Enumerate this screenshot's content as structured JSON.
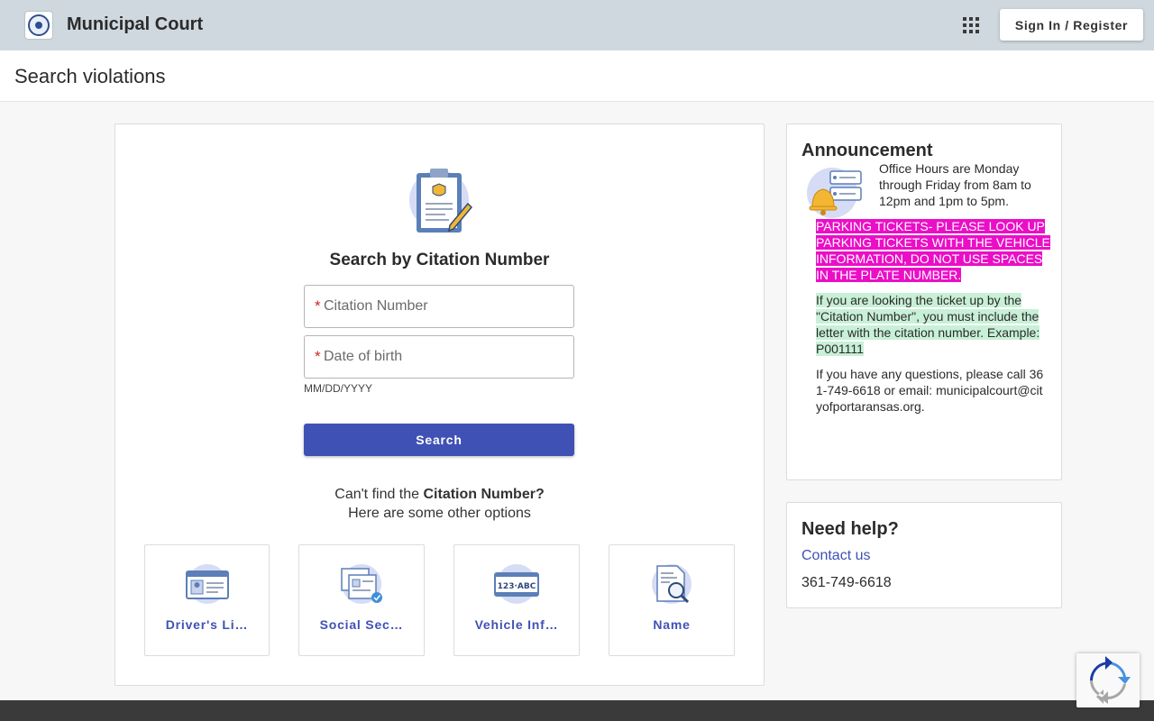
{
  "header": {
    "app_title": "Municipal Court",
    "signin_label": "Sign In / Register"
  },
  "page": {
    "title": "Search violations"
  },
  "search": {
    "heading": "Search by Citation Number",
    "citation_placeholder": "Citation Number",
    "dob_placeholder": "Date of birth",
    "dob_hint": "MM/DD/YYYY",
    "button_label": "Search",
    "cant_find_prefix": "Can't find the ",
    "cant_find_bold": "Citation Number?",
    "other_options": "Here are some other options"
  },
  "options": [
    {
      "label": "Driver's Li…",
      "icon": "drivers-license-icon"
    },
    {
      "label": "Social Sec…",
      "icon": "social-security-icon"
    },
    {
      "label": "Vehicle Inf…",
      "icon": "vehicle-info-icon"
    },
    {
      "label": "Name",
      "icon": "name-search-icon"
    }
  ],
  "announcement": {
    "title": "Announcement",
    "hours": "Office Hours are Monday through Friday from 8am to 12pm and 1pm to 5pm.",
    "parking": "PARKING TICKETS-  PLEASE LOOK UP PARKING TICKETS WITH THE VEHICLE INFORMATION, DO NOT USE SPACES IN THE PLATE NUMBER.",
    "citation_note": "If you are looking the ticket up by the \"Citation Number\", you must include the letter with the citation number.  Example:  P001111",
    "contact": "If you have any questions, please call 361-749-6618 or email: municipalcourt@cityofportaransas.org."
  },
  "help": {
    "title": "Need help?",
    "contact_label": "Contact us",
    "phone": "361-749-6618"
  },
  "colors": {
    "primary": "#3f51b5",
    "topbar": "#cfd8de",
    "parking_highlight": "#ea0fc7",
    "citation_highlight": "#c8f0d6"
  }
}
